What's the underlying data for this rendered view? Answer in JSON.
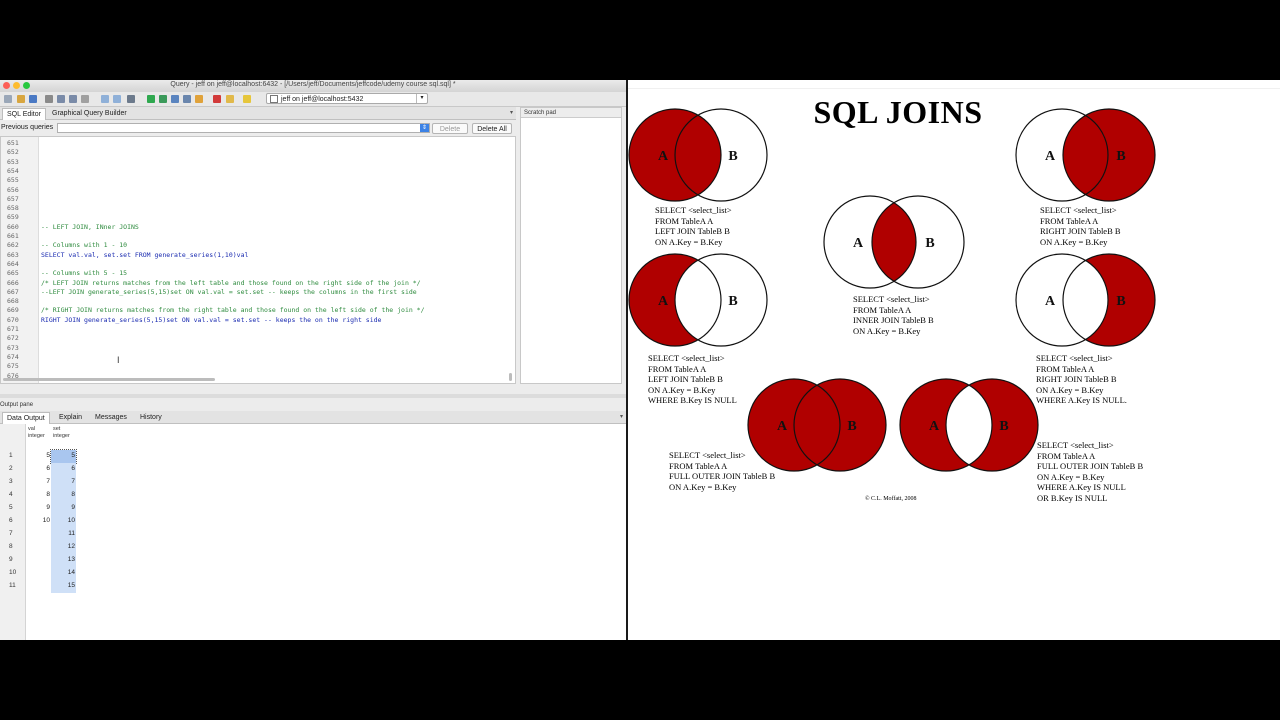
{
  "window": {
    "title": "Query - jeff on jeff@localhost:6432 - [/Users/jeff/Documents/jeffcode/udemy course sql.sql] *",
    "connection": "jeff on jeff@localhost:5432"
  },
  "tabs": [
    {
      "label": "SQL Editor",
      "active": true
    },
    {
      "label": "Graphical Query Builder",
      "active": false
    }
  ],
  "previous_queries": {
    "label": "Previous queries",
    "delete_label": "Delete",
    "delete_all_label": "Delete All"
  },
  "scratch_pad": {
    "label": "Scratch pad"
  },
  "editor": {
    "lines": [
      {
        "num": "651",
        "text": ""
      },
      {
        "num": "652",
        "text": ""
      },
      {
        "num": "653",
        "text": ""
      },
      {
        "num": "654",
        "text": ""
      },
      {
        "num": "655",
        "text": ""
      },
      {
        "num": "656",
        "text": ""
      },
      {
        "num": "657",
        "text": ""
      },
      {
        "num": "658",
        "text": ""
      },
      {
        "num": "659",
        "text": ""
      },
      {
        "num": "660",
        "text": "-- LEFT JOIN, INner JOINS",
        "kind": "comment"
      },
      {
        "num": "661",
        "text": ""
      },
      {
        "num": "662",
        "text": "-- Columns with 1 - 10",
        "kind": "comment"
      },
      {
        "num": "663",
        "text": "SELECT val.val, set.set FROM generate_series(1,10)val",
        "kind": "code"
      },
      {
        "num": "664",
        "text": ""
      },
      {
        "num": "665",
        "text": "-- Columns with 5 - 15",
        "kind": "comment"
      },
      {
        "num": "666",
        "text": "/* LEFT JOIN returns matches from the left table and those found on the right side of the join */",
        "kind": "comment"
      },
      {
        "num": "667",
        "text": "--LEFT JOIN generate_series(5,15)set ON val.val = set.set -- keeps the columns in the first side",
        "kind": "comment"
      },
      {
        "num": "668",
        "text": ""
      },
      {
        "num": "669",
        "text": "/* RIGHT JOIN returns matches from the right table and those found on the left side of the join */",
        "kind": "comment"
      },
      {
        "num": "670",
        "text": "RIGHT JOIN generate_series(5,15)set ON val.val = set.set -- keeps the on the right side",
        "kind": "code"
      },
      {
        "num": "671",
        "text": ""
      },
      {
        "num": "672",
        "text": ""
      },
      {
        "num": "673",
        "text": ""
      },
      {
        "num": "674",
        "text": ""
      },
      {
        "num": "675",
        "text": ""
      },
      {
        "num": "676",
        "text": ""
      }
    ]
  },
  "output": {
    "label": "Output pane",
    "tabs": [
      "Data Output",
      "Explain",
      "Messages",
      "History"
    ],
    "columns": [
      {
        "name": "val",
        "type": "integer"
      },
      {
        "name": "set",
        "type": "integer"
      }
    ],
    "rows": [
      {
        "n": "1",
        "val": "5",
        "set": "5"
      },
      {
        "n": "2",
        "val": "6",
        "set": "6"
      },
      {
        "n": "3",
        "val": "7",
        "set": "7"
      },
      {
        "n": "4",
        "val": "8",
        "set": "8"
      },
      {
        "n": "5",
        "val": "9",
        "set": "9"
      },
      {
        "n": "6",
        "val": "10",
        "set": "10"
      },
      {
        "n": "7",
        "val": "",
        "set": "11"
      },
      {
        "n": "8",
        "val": "",
        "set": "12"
      },
      {
        "n": "9",
        "val": "",
        "set": "13"
      },
      {
        "n": "10",
        "val": "",
        "set": "14"
      },
      {
        "n": "11",
        "val": "",
        "set": "15"
      }
    ]
  },
  "sql_joins": {
    "title": "SQL JOINS",
    "fill_color": "#b00000",
    "label_a": "A",
    "label_b": "B",
    "captions": [
      [
        "SELECT <select_list>",
        "FROM TableA A",
        "LEFT JOIN TableB B",
        "ON A.Key = B.Key"
      ],
      [
        "SELECT <select_list>",
        "FROM TableA A",
        "INNER JOIN TableB B",
        "ON A.Key = B.Key"
      ],
      [
        "SELECT <select_list>",
        "FROM TableA A",
        "RIGHT JOIN TableB B",
        "ON A.Key = B.Key"
      ],
      [
        "SELECT <select_list>",
        "FROM TableA A",
        "LEFT JOIN TableB B",
        "ON A.Key = B.Key",
        "WHERE B.Key IS NULL"
      ],
      [
        "SELECT <select_list>",
        "FROM TableA A",
        "RIGHT JOIN TableB B",
        "ON A.Key = B.Key",
        "WHERE A.Key IS NULL."
      ],
      [
        "SELECT <select_list>",
        "FROM TableA A",
        "FULL OUTER JOIN TableB B",
        "ON A.Key = B.Key"
      ],
      [
        "SELECT <select_list>",
        "FROM TableA A",
        "FULL OUTER JOIN TableB B",
        "ON A.Key = B.Key",
        "WHERE A.Key IS NULL",
        "OR B.Key IS NULL"
      ]
    ],
    "copyright": "© C.L. Moffatt, 2008"
  }
}
